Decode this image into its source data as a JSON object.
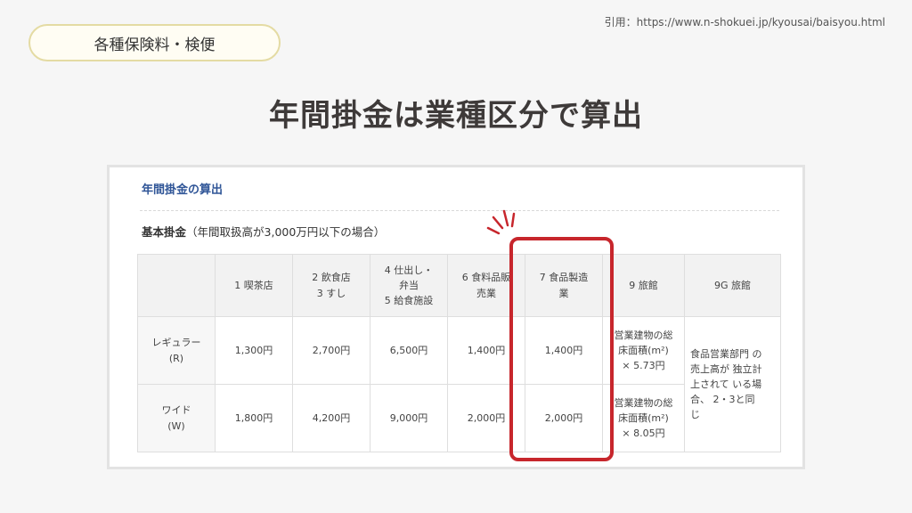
{
  "citation": "引用：https://www.n-shokuei.jp/kyousai/baisyou.html",
  "category_label": "各種保険料・検便",
  "title": "年間掛金は業種区分で算出",
  "panel": {
    "heading": "年間掛金の算出",
    "subheading_bold": "基本掛金",
    "subheading_note": "（年間取扱高が3,000万円以下の場合）"
  },
  "table": {
    "headers": [
      "",
      "1 喫茶店",
      [
        "2 飲食店",
        "3 すし"
      ],
      [
        "4 仕出し・",
        "弁当",
        "5 給食施設"
      ],
      [
        "6 食料品販",
        "売業"
      ],
      [
        "7 食品製造",
        "業"
      ],
      "9 旅館",
      "9G 旅館"
    ],
    "rows": [
      {
        "label": [
          "レギュラー",
          "(R)"
        ],
        "values": [
          "1,300円",
          "2,700円",
          "6,500円",
          "1,400円",
          "1,400円"
        ],
        "ryokan": [
          "営業建物の総",
          "床面積(m²)",
          "× 5.73円"
        ]
      },
      {
        "label": [
          "ワイド",
          "(W)"
        ],
        "values": [
          "1,800円",
          "4,200円",
          "9,000円",
          "2,000円",
          "2,000円"
        ],
        "ryokan": [
          "営業建物の総",
          "床面積(m²)",
          "× 8.05円"
        ]
      }
    ],
    "ryokan_g": [
      "食品営業部門 の",
      "売上高が 独立計",
      "上されて いる場",
      "合、 2・3と同",
      "じ"
    ]
  },
  "colors": {
    "highlight": "#c7262c",
    "heading_blue": "#2f5597",
    "pill_border": "#e4dba3"
  }
}
